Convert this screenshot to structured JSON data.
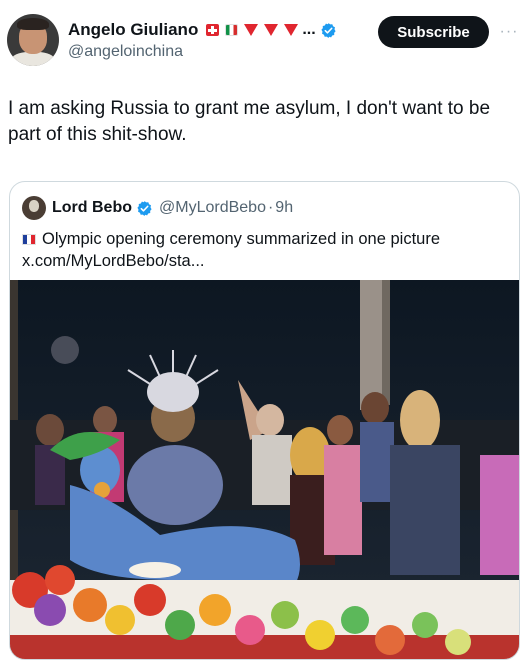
{
  "post": {
    "author_name": "Angelo Giuliano",
    "author_handle": "@angeloinchina",
    "name_suffix": "...",
    "subscribe_label": "Subscribe",
    "more_label": "···",
    "text": "I am asking Russia to grant me asylum, I don't want to be part of this shit-show."
  },
  "quoted": {
    "author_name": "Lord Bebo",
    "author_handle": "@MyLordBebo",
    "separator": "·",
    "time": "9h",
    "text": "Olympic opening ceremony summarized in one picture",
    "link": "x.com/MyLordBebo/sta..."
  },
  "colors": {
    "verified_blue": "#1d9bf0",
    "subscribe_bg": "#0f1419",
    "muted_text": "#536471"
  },
  "icons": {
    "author_flags": [
      "swiss-flag-icon",
      "italy-flag-icon",
      "red-triangle-icon",
      "red-triangle-icon",
      "red-triangle-icon"
    ],
    "quoted_flag": "france-flag-icon",
    "verified": "verified-badge-icon"
  }
}
